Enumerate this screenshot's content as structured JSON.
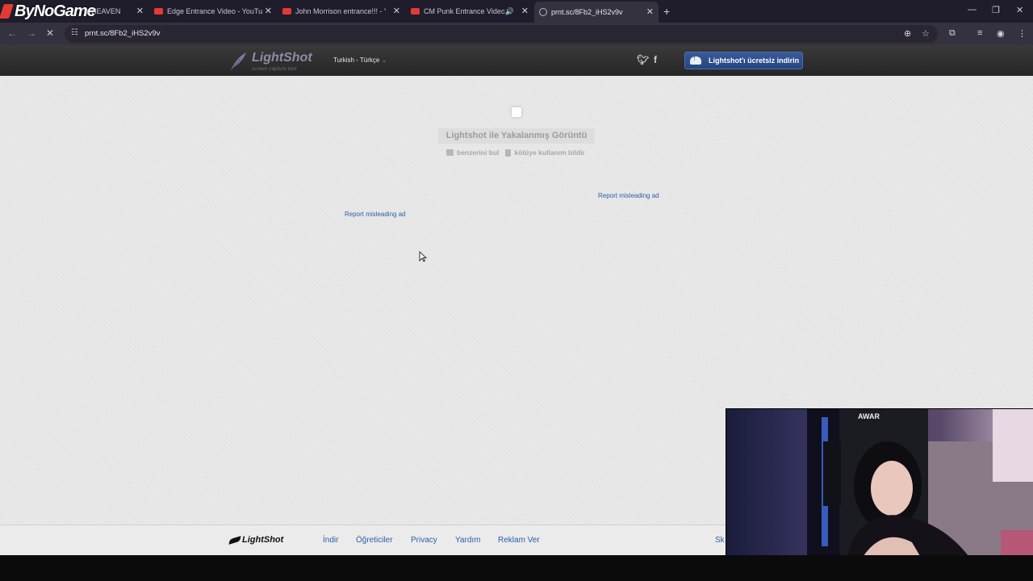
{
  "overlay": {
    "brand": "ByNoGame"
  },
  "tabs": [
    {
      "title": "is HEAVEN",
      "favicon": "youtube-icon"
    },
    {
      "title": "Edge Entrance Video - YouTube",
      "favicon": "youtube-icon"
    },
    {
      "title": "John Morrison entrance!!! - Yo",
      "favicon": "youtube-icon"
    },
    {
      "title": "CM Punk Entrance Video - ",
      "favicon": "youtube-icon"
    },
    {
      "title": "prnt.sc/8Fb2_iHS2v9v",
      "favicon": "globe-icon"
    }
  ],
  "address": {
    "url": "prnt.sc/8Fb2_iHS2v9v"
  },
  "lightshot": {
    "logo": "LightShot",
    "logo_sub": "screen capture tool",
    "language": "Turkish - Türkçe",
    "download_button": "Lightshot'ı ücretsiz indirin",
    "caption": "Lightshot ile Yakalanmış Görüntü",
    "find_similar": "benzerini bul",
    "report_abuse": "kötüye kullanım bildir",
    "report_ad_1": "Report misleading ad",
    "report_ad_2": "Report misleading ad"
  },
  "footer": {
    "logo": "LightShot",
    "links": [
      "İndir",
      "Öğreticiler",
      "Privacy",
      "Yardım",
      "Reklam Ver",
      "Sk"
    ]
  },
  "colors": {
    "tabstrip": "#1f1d2b",
    "toolbar": "#35323f",
    "lightshot_header": "#2b2b2b",
    "page_bg": "#e9e9e9",
    "link": "#2a5fa8",
    "download_button": "#2c4f8c"
  }
}
